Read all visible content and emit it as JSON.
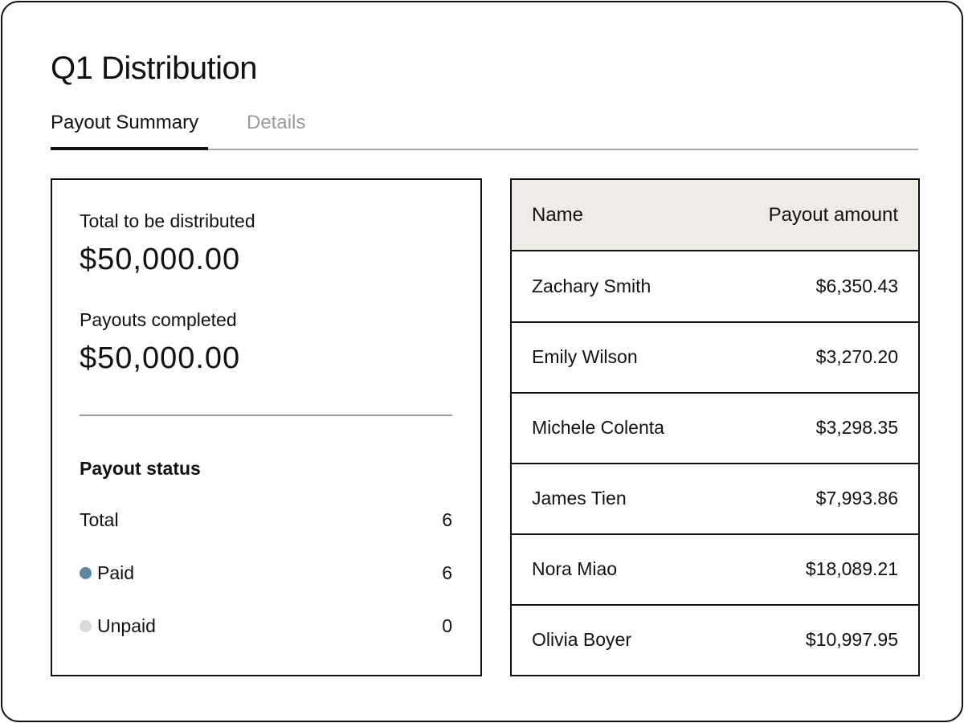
{
  "page": {
    "title": "Q1 Distribution"
  },
  "tabs": [
    {
      "label": "Payout Summary",
      "active": true
    },
    {
      "label": "Details",
      "active": false
    }
  ],
  "summary": {
    "total_label": "Total to be distributed",
    "total_value": "$50,000.00",
    "completed_label": "Payouts completed",
    "completed_value": "$50,000.00",
    "status_title": "Payout status",
    "status_rows": [
      {
        "label": "Total",
        "count": "6"
      },
      {
        "label": "Paid",
        "count": "6",
        "dot_color": "#5b86a7"
      },
      {
        "label": "Unpaid",
        "count": "0",
        "dot_color": "#d9d9d9"
      }
    ]
  },
  "table": {
    "headers": {
      "name": "Name",
      "amount": "Payout amount"
    },
    "header_bg": "#efebe7",
    "rows": [
      {
        "name": "Zachary Smith",
        "amount": "$6,350.43"
      },
      {
        "name": "Emily Wilson",
        "amount": "$3,270.20"
      },
      {
        "name": "Michele Colenta",
        "amount": "$3,298.35"
      },
      {
        "name": "James Tien",
        "amount": "$7,993.86"
      },
      {
        "name": "Nora Miao",
        "amount": "$18,089.21"
      },
      {
        "name": "Olivia Boyer",
        "amount": "$10,997.95"
      }
    ]
  }
}
